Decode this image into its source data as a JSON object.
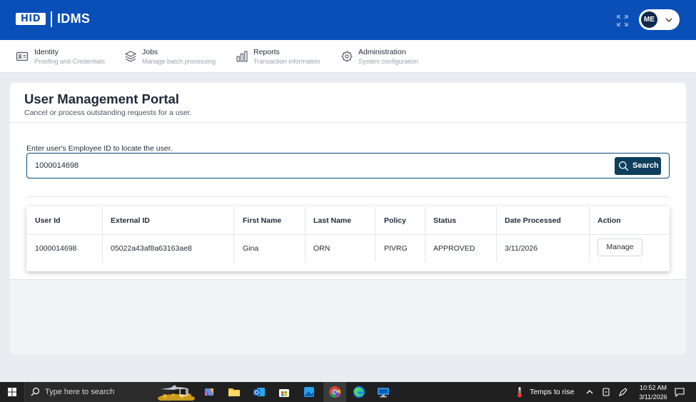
{
  "header": {
    "logo_text": "HID",
    "app_name": "IDMS",
    "user_initials": "ME",
    "brand_color": "#0a4fb8"
  },
  "nav": {
    "items": [
      {
        "title": "Identity",
        "subtitle": "Proofing and Credentials",
        "icon": "id-card-icon"
      },
      {
        "title": "Jobs",
        "subtitle": "Manage batch processing",
        "icon": "layers-icon"
      },
      {
        "title": "Reports",
        "subtitle": "Transaction information",
        "icon": "bar-chart-icon"
      },
      {
        "title": "Administration",
        "subtitle": "System configuration",
        "icon": "gear-icon"
      }
    ]
  },
  "page": {
    "title": "User Management Portal",
    "subtitle": "Cancel or process outstanding requests for a user."
  },
  "search": {
    "label": "Enter user's Employee ID to locate the user.",
    "value": "1000014698",
    "button_label": "Search"
  },
  "table": {
    "headers": [
      "User Id",
      "External ID",
      "First Name",
      "Last Name",
      "Policy",
      "Status",
      "Date Processed",
      "Action"
    ],
    "rows": [
      {
        "user_id": "1000014698",
        "external_id": "05022a43af8a63163ae8",
        "first_name": "Gina",
        "last_name": "ORN",
        "policy": "PIVRG",
        "status": "APPROVED",
        "date_processed": "3/11/2026",
        "action": "Manage"
      }
    ]
  },
  "taskbar": {
    "search_placeholder": "Type here to search",
    "weather": "Temps to rise",
    "time": "10:52 AM",
    "date": "3/11/2026"
  }
}
